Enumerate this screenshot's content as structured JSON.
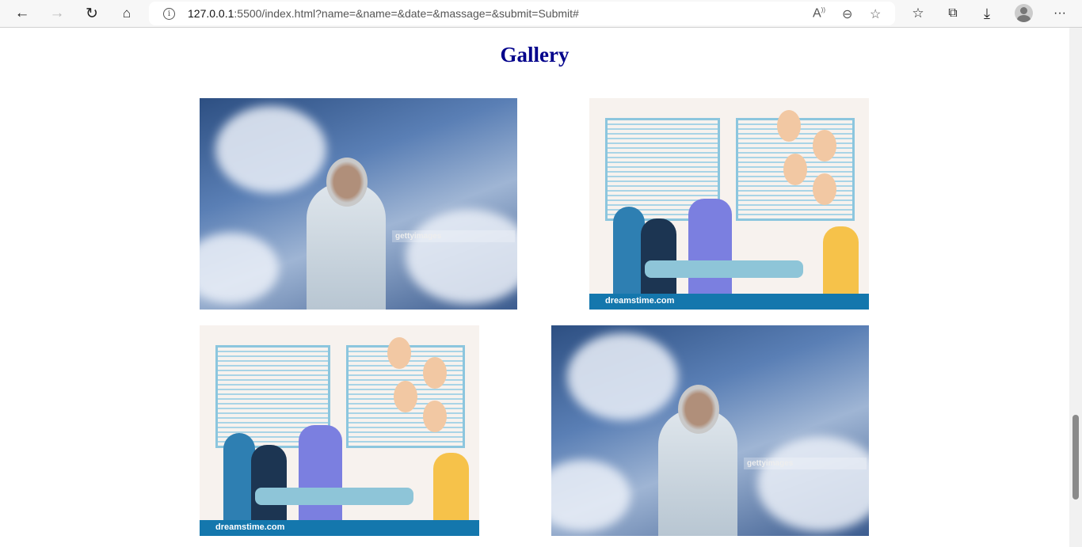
{
  "browser": {
    "url_host": "127.0.0.1",
    "url_rest": ":5500/index.html?name=&name=&date=&massage=&submit=Submit#"
  },
  "page": {
    "title": "Gallery"
  },
  "gallery": [
    {
      "kind": "photo",
      "watermark": "gettyimages"
    },
    {
      "kind": "illustration",
      "watermark": "dreamstime.com"
    },
    {
      "kind": "illustration",
      "watermark": "dreamstime.com"
    },
    {
      "kind": "photo",
      "watermark": "gettyimages"
    }
  ]
}
